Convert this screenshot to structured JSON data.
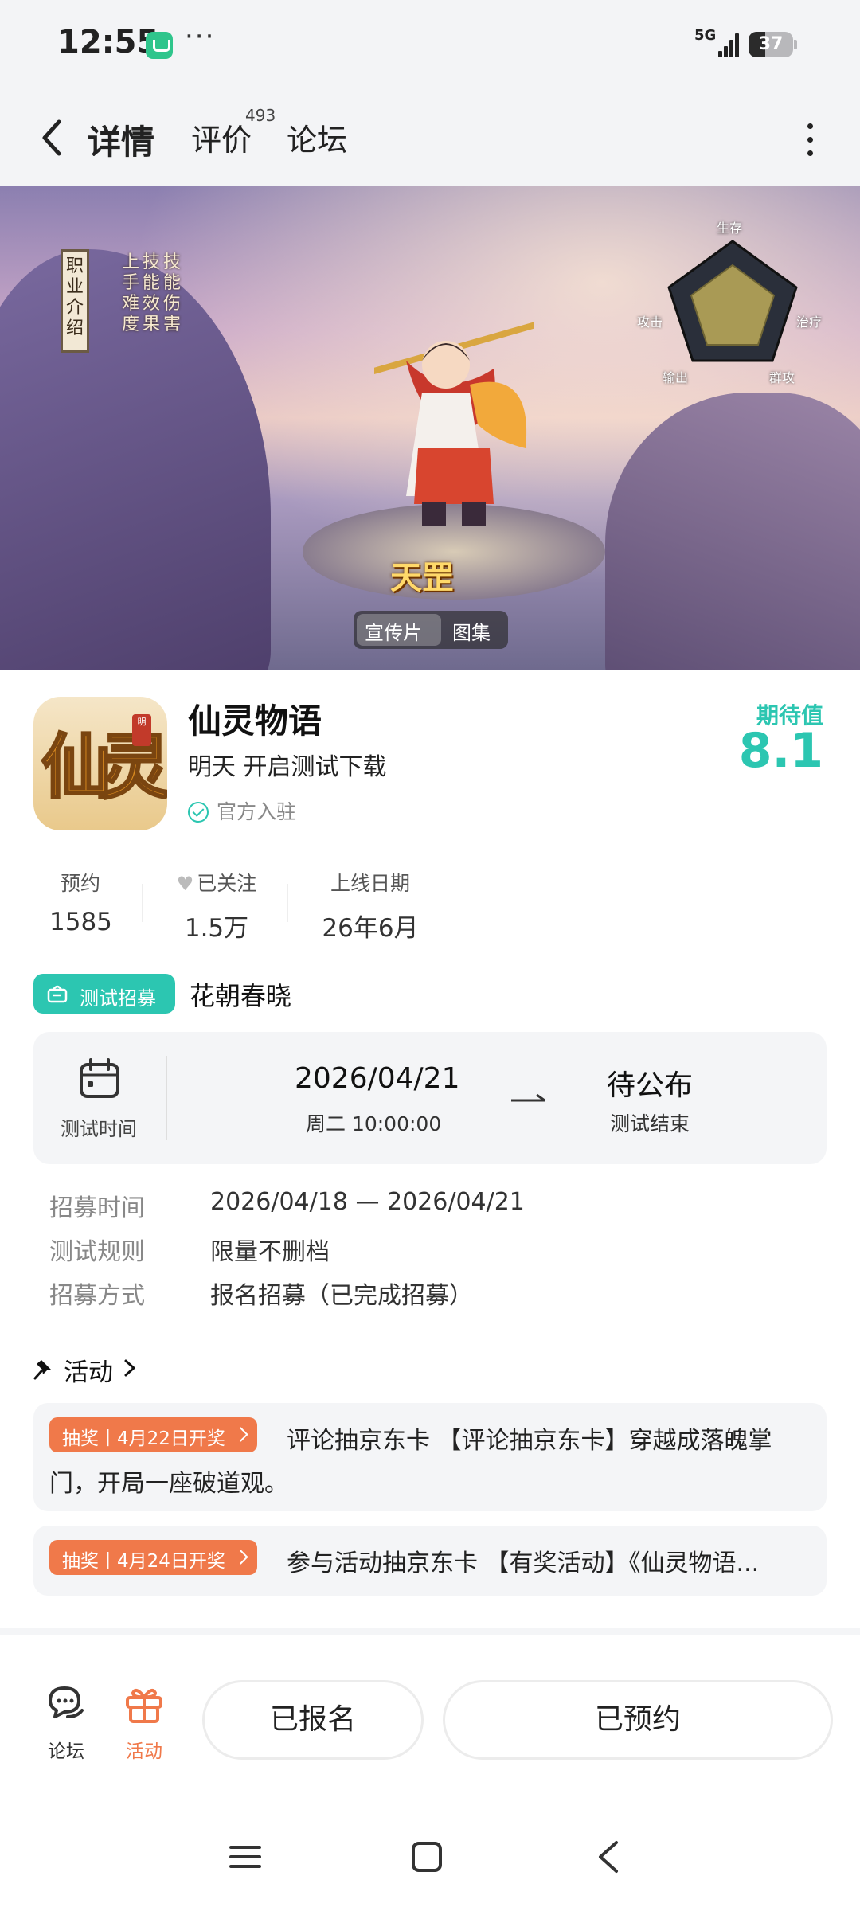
{
  "status_bar": {
    "time": "12:55",
    "dots": "···",
    "network": "5G",
    "battery": "37",
    "battery_level": 0.37
  },
  "nav": {
    "tabs": [
      {
        "label": "详情"
      },
      {
        "label": "评价",
        "count": "493"
      },
      {
        "label": "论坛"
      }
    ]
  },
  "banner": {
    "hero_name": "天罡",
    "side_tag": "职业介绍",
    "vertical_labels": [
      "上手难度",
      "技能效果",
      "技能伤害"
    ],
    "radar_labels": {
      "top": "生存",
      "left": "攻击",
      "right": "治疗",
      "bottom_left": "输出",
      "bottom_right": "群攻"
    },
    "media_options": [
      "宣传片",
      "图集"
    ],
    "media_selected": "宣传片"
  },
  "game": {
    "icon_glyph": "仙灵",
    "icon_seal": "明",
    "title": "仙灵物语",
    "subtitle": "明天 开启测试下载",
    "verified_label": "官方入驻",
    "expect_label": "期待值",
    "expect_value": "8.1"
  },
  "stats": [
    {
      "label": "预约",
      "value": "1585"
    },
    {
      "label": "已关注",
      "value": "1.5万"
    },
    {
      "label": "上线日期",
      "value": "26年6月"
    }
  ],
  "recruit": {
    "badge": "测试招募",
    "name": "花朝春晓",
    "test_time_label": "测试时间",
    "start_date": "2026/04/21",
    "start_time": "周二  10:00:00",
    "end_status": "待公布",
    "end_label": "测试结束",
    "details": [
      {
        "key": "招募时间",
        "value": "2026/04/18 — 2026/04/21"
      },
      {
        "key": "测试规则",
        "value": "限量不删档"
      },
      {
        "key": "招募方式",
        "value": "报名招募（已完成招募）"
      }
    ]
  },
  "activities": {
    "header": "活动",
    "items": [
      {
        "badge": "抽奖丨4月22日开奖",
        "text_line1": "评论抽京东卡 【评论抽京东卡】穿越成落魄掌",
        "text_line2": "门，开局一座破道观。"
      },
      {
        "badge": "抽奖丨4月24日开奖",
        "text_line1": "参与活动抽京东卡 【有奖活动】《仙灵物语..."
      }
    ]
  },
  "bottom_bar": {
    "forum_label": "论坛",
    "activity_label": "活动",
    "signed_up_label": "已报名",
    "reserved_label": "已预约"
  },
  "colors": {
    "accent": "#2cc6b1",
    "orange": "#f0794a"
  }
}
